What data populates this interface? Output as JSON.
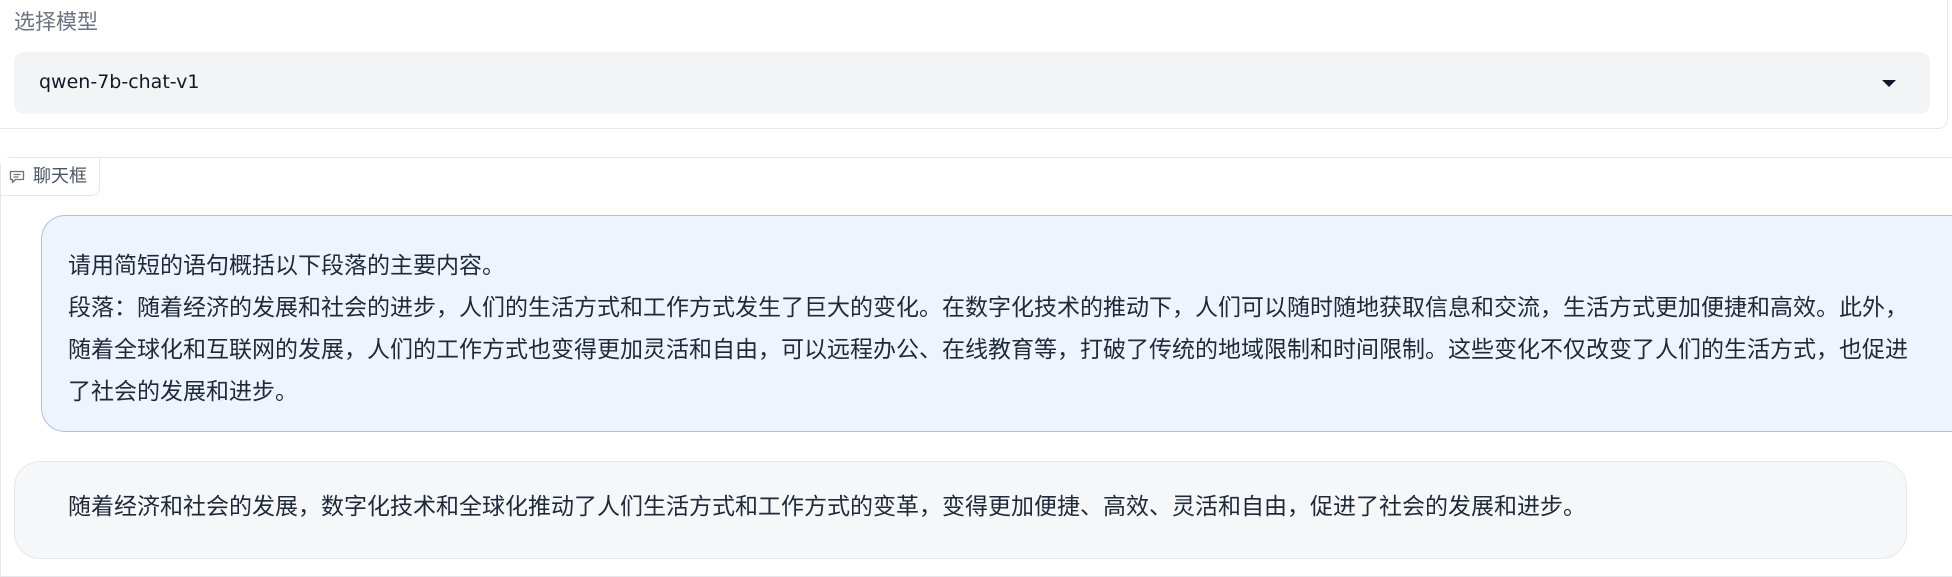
{
  "model_selector": {
    "label": "选择模型",
    "selected_value": "qwen-7b-chat-v1"
  },
  "chat": {
    "tab_label": "聊天框",
    "messages": [
      {
        "role": "user",
        "text": "请用简短的语句概括以下段落的主要内容。\n段落：随着经济的发展和社会的进步，人们的生活方式和工作方式发生了巨大的变化。在数字化技术的推动下，人们可以随时随地获取信息和交流，生活方式更加便捷和高效。此外，随着全球化和互联网的发展，人们的工作方式也变得更加灵活和自由，可以远程办公、在线教育等，打破了传统的地域限制和时间限制。这些变化不仅改变了人们的生活方式，也促进了社会的发展和进步。"
      },
      {
        "role": "assistant",
        "text": "随着经济和社会的发展，数字化技术和全球化推动了人们生活方式和工作方式的变革，变得更加便捷、高效、灵活和自由，促进了社会的发展和进步。"
      }
    ]
  },
  "icons": {
    "dropdown": "chevron-down-icon",
    "chat": "chat-bubble-icon"
  }
}
